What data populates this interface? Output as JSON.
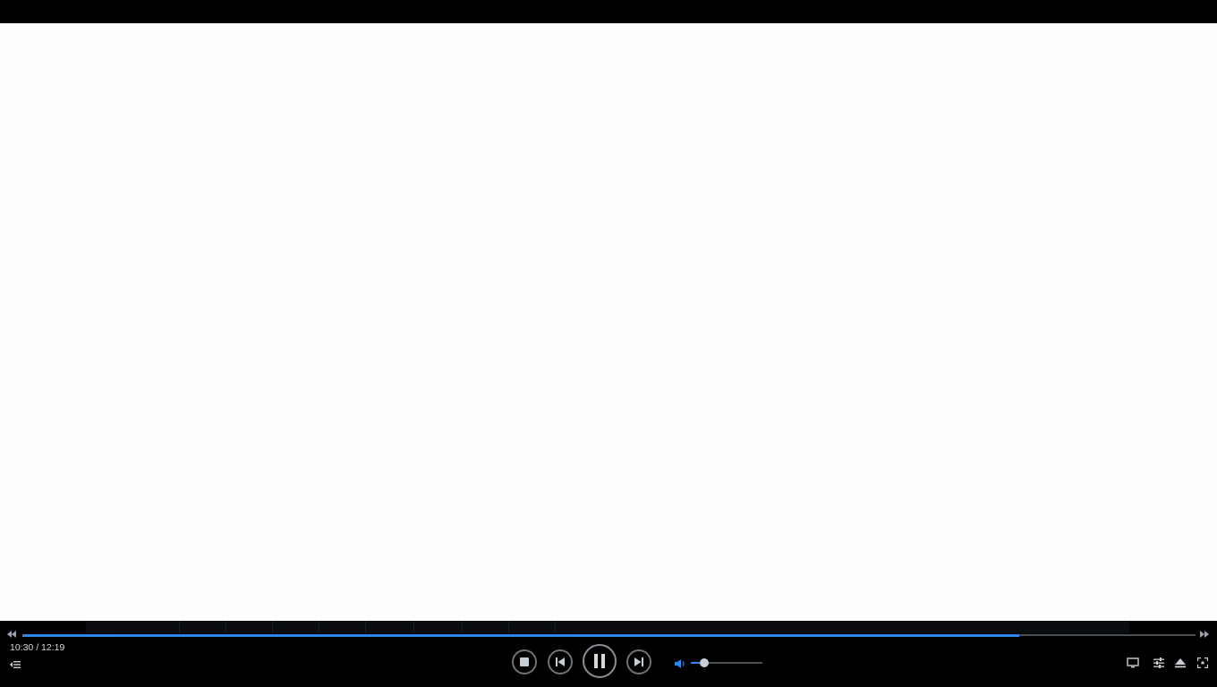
{
  "player": {
    "time_current": "10:30",
    "time_separator": " / ",
    "time_total": "12:19",
    "progress_fraction": 0.85,
    "volume_fraction": 0.19
  },
  "icons": {
    "seek_back": "rewind-icon",
    "seek_forward": "fast-forward-icon",
    "playlist": "playlist-icon",
    "stop": "stop-icon",
    "previous": "previous-track-icon",
    "pause": "pause-icon",
    "next": "next-track-icon",
    "volume": "speaker-icon",
    "screen": "monitor-icon",
    "settings": "equalizer-icon",
    "eject": "eject-icon",
    "fullscreen": "fullscreen-icon"
  },
  "colors": {
    "accent": "#2f86e6",
    "background": "#000000",
    "video_area": "#fefefe",
    "control_ring": "#6d737a",
    "icon": "#c9ced4"
  }
}
